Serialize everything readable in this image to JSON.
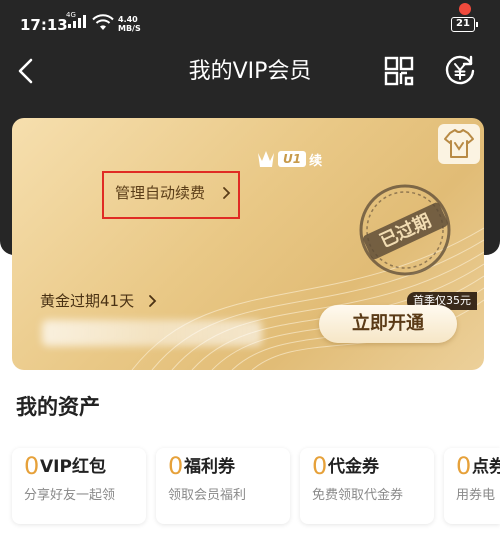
{
  "status_bar": {
    "time": "17:13",
    "network": "4G",
    "speed_value": "4.40",
    "speed_unit": "MB/S",
    "battery": "21"
  },
  "nav": {
    "title": "我的VIP会员",
    "back_icon": "chevron-left-icon",
    "qr_icon": "qr-code-icon",
    "yuan_icon": "yuan-refresh-icon"
  },
  "vip_card": {
    "logo_text": "U1",
    "logo_suffix": "续",
    "manage_label": "管理自动续费",
    "stamp_text": "已过期",
    "gold_expire": "黄金过期41天",
    "first_season_tag": "首季仅35元",
    "open_button": "立即开通",
    "colors": {
      "card_gold": "#e9c886",
      "highlight_box": "#e02b24",
      "badge_dot": "#f04a3c"
    }
  },
  "assets": {
    "title": "我的资产",
    "items": [
      {
        "count": "0",
        "name": "VIP红包",
        "desc": "分享好友一起领"
      },
      {
        "count": "0",
        "name": "福利券",
        "desc": "领取会员福利"
      },
      {
        "count": "0",
        "name": "代金券",
        "desc": "免费领取代金券"
      },
      {
        "count": "0",
        "name": "点券",
        "desc": "用券电"
      }
    ]
  }
}
